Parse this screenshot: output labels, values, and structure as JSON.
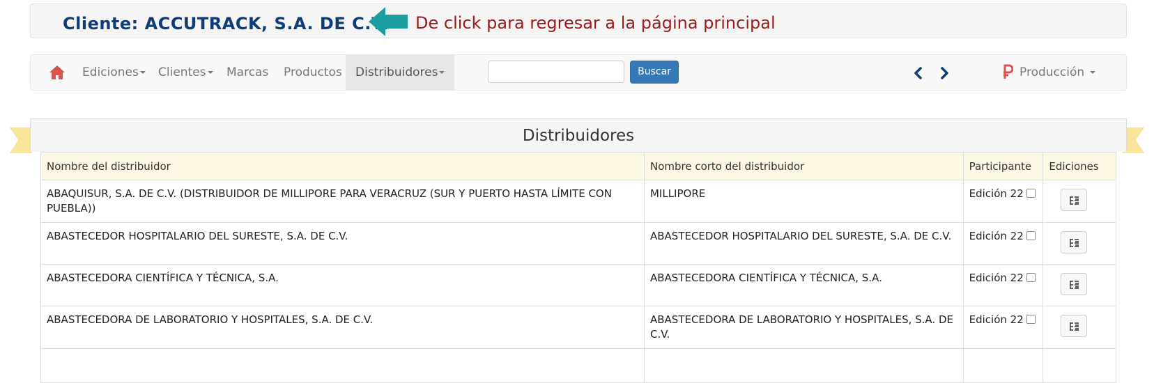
{
  "header": {
    "client_label": "Cliente: ACCUTRACK, S.A. DE C.V.",
    "back_link": "De click para regresar a la página principal",
    "colors": {
      "client": "#0d3c78",
      "arrow": "#1a9e9e",
      "back_link": "#9b1b1b"
    }
  },
  "navbar": {
    "items": [
      {
        "label": "Ediciones",
        "dropdown": true
      },
      {
        "label": "Clientes",
        "dropdown": true
      },
      {
        "label": "Marcas",
        "dropdown": false
      },
      {
        "label": "Productos",
        "dropdown": false
      },
      {
        "label": "Distribuidores",
        "dropdown": true,
        "active": true
      }
    ],
    "search": {
      "value": "",
      "placeholder": ""
    },
    "search_button": "Buscar",
    "right_menu": "Producción",
    "icons": [
      "home-icon",
      "chevron-left-icon",
      "chevron-right-icon",
      "ruble-icon"
    ]
  },
  "panel": {
    "title": "Distribuidores",
    "columns": [
      "Nombre del distribuidor",
      "Nombre corto del distribuidor",
      "Participante",
      "Ediciones"
    ],
    "rows": [
      {
        "name": "ABAQUISUR, S.A. DE C.V. (DISTRIBUIDOR DE MILLIPORE PARA VERACRUZ (SUR Y PUERTO HASTA LÍMITE CON PUEBLA))",
        "short": "MILLIPORE",
        "participant": "Edición 22",
        "checked": false
      },
      {
        "name": "ABASTECEDOR HOSPITALARIO DEL SURESTE, S.A. DE C.V.",
        "short": "ABASTECEDOR HOSPITALARIO DEL SURESTE, S.A. DE C.V.",
        "participant": "Edición 22",
        "checked": false
      },
      {
        "name": "ABASTECEDORA CIENTÍFICA Y TÉCNICA, S.A.",
        "short": "ABASTECEDORA CIENTÍFICA Y TÉCNICA, S.A.",
        "participant": "Edición 22",
        "checked": false
      },
      {
        "name": "ABASTECEDORA DE LABORATORIO Y HOSPITALES, S.A. DE C.V.",
        "short": "ABASTECEDORA DE LABORATORIO Y HOSPITALES, S.A. DE C.V.",
        "participant": "Edición 22",
        "checked": false
      }
    ]
  }
}
